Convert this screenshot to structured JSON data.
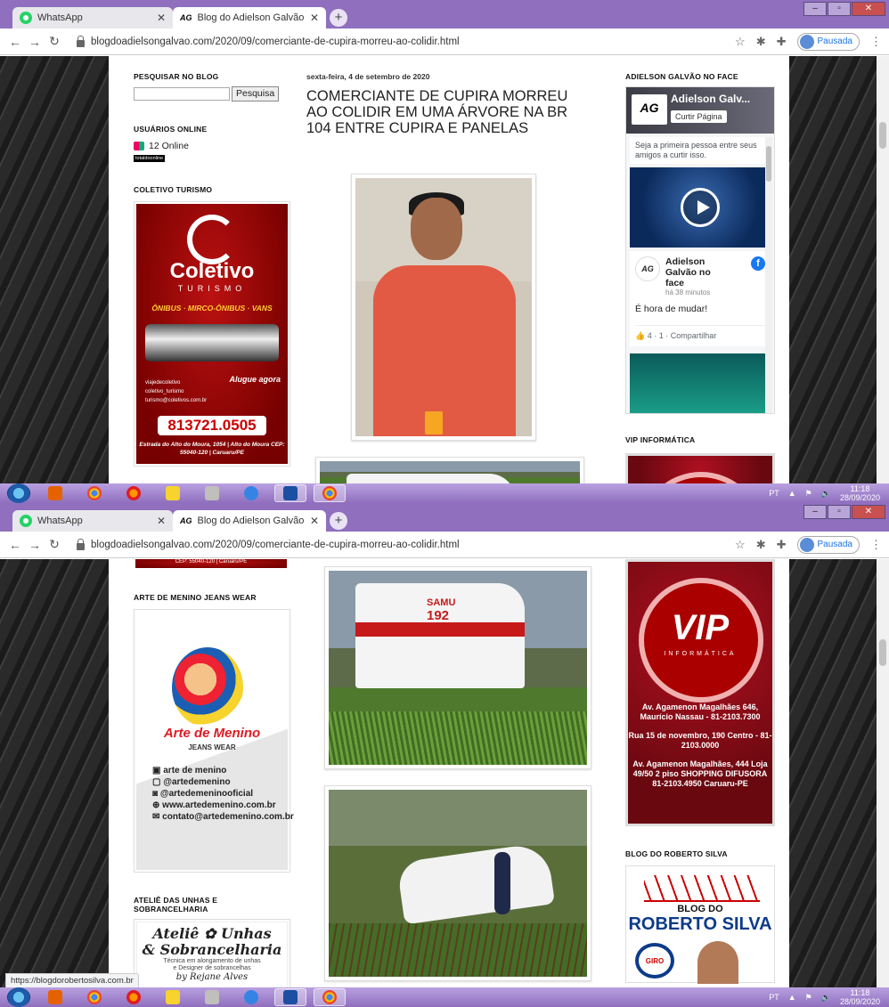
{
  "browser": {
    "tabs": [
      {
        "label": "WhatsApp"
      },
      {
        "label": "Blog do Adielson Galvão: COMER"
      }
    ],
    "tab_favicon_text": "AG",
    "url": "blogdoadielsongalvao.com/2020/09/comerciante-de-cupira-morreu-ao-colidir.html",
    "profile_status": "Pausada",
    "hover_link": "https://blogdorobertosilva.com.br"
  },
  "sidebar_left": {
    "search_heading": "PESQUISAR NO BLOG",
    "search_button": "Pesquisa",
    "online_heading": "USUÁRIOS ONLINE",
    "online_count": "12 Online",
    "online_badge": "totaldoonline",
    "coletivo_heading": "COLETIVO TURISMO",
    "arte_heading": "ARTE DE MENINO JEANS WEAR",
    "atelie_heading": "ATELIÊ DAS UNHAS E SOBRANCELHARIA"
  },
  "ads": {
    "coletivo": {
      "name": "Coletivo",
      "sub": "TURISMO",
      "services": "ÔNIBUS · MIRCO-ÔNIBUS · VANS",
      "cta": "Alugue agora",
      "social": [
        "viajedecoletivo",
        "coletivo_turismo",
        "turismo@coletivos.com.br"
      ],
      "phone": "813721.0505",
      "address": "Estrada do Alto do Moura, 1054 | Alto do Moura CEP: 55040-120 | Caruaru/PE",
      "address_tail": "CEP: 55040-120 | Caruaru/PE"
    },
    "arte": {
      "brand": "Arte de Menino",
      "sub": "JEANS WEAR",
      "lines": [
        "arte de menino",
        "@artedemenino",
        "@artedemeninooficial",
        "www.artedemenino.com.br",
        "contato@artedemenino.com.br"
      ]
    },
    "atelie": {
      "title1": "Ateliê",
      "title1b": "Unhas",
      "title2": "& Sobrancelharia",
      "sub1": "Técnica em alongamento de unhas",
      "sub2": "e Designer de sobrancelhas",
      "by": "by Rejane Alves"
    },
    "vip": {
      "logo": "VIP",
      "sub": "INFORMÁTICA",
      "info": [
        "Av. Agamenon Magalhães 646, Maurício Nassau - 81-2103.7300",
        "Rua 15 de novembro, 190 Centro - 81-2103.0000",
        "Av. Agamenon Magalhães, 444 Loja 49/50 2 piso SHOPPING DIFUSORA 81-2103.4950 Caruaru-PE"
      ]
    },
    "roberto": {
      "line1": "BLOG DO",
      "line2": "ROBERTO SILVA",
      "giro": "GIRO"
    }
  },
  "post": {
    "date": "sexta-feira, 4 de setembro de 2020",
    "title": "COMERCIANTE DE CUPIRA MORREU AO COLIDIR EM UMA ÁRVORE NA BR 104 ENTRE CUPIRA E PANELAS",
    "ambulance_label": "SAMU",
    "ambulance_number": "192"
  },
  "sidebar_right": {
    "face_heading": "ADIELSON GALVÃO NO FACE",
    "fb_logo": "AG",
    "fb_page": "Adielson Galv...",
    "fb_like": "Curtir Página",
    "fb_first": "Seja a primeira pessoa entre seus amigos a curtir isso.",
    "fb_post_name": "Adielson Galvão no face",
    "fb_time": "há 38 minutos",
    "fb_msg": "É hora de mudar!",
    "fb_actions": "4 · 1 · Compartilhar",
    "vip_heading": "VIP INFORMÁTICA",
    "roberto_heading": "BLOG DO ROBERTO SILVA"
  },
  "taskbar": {
    "lang": "PT",
    "time": "11:18",
    "date": "28/09/2020"
  },
  "colors": {
    "accent": "#8f6fbe",
    "fb_blue": "#1877f2",
    "coletivo_red": "#9a0d0d"
  }
}
